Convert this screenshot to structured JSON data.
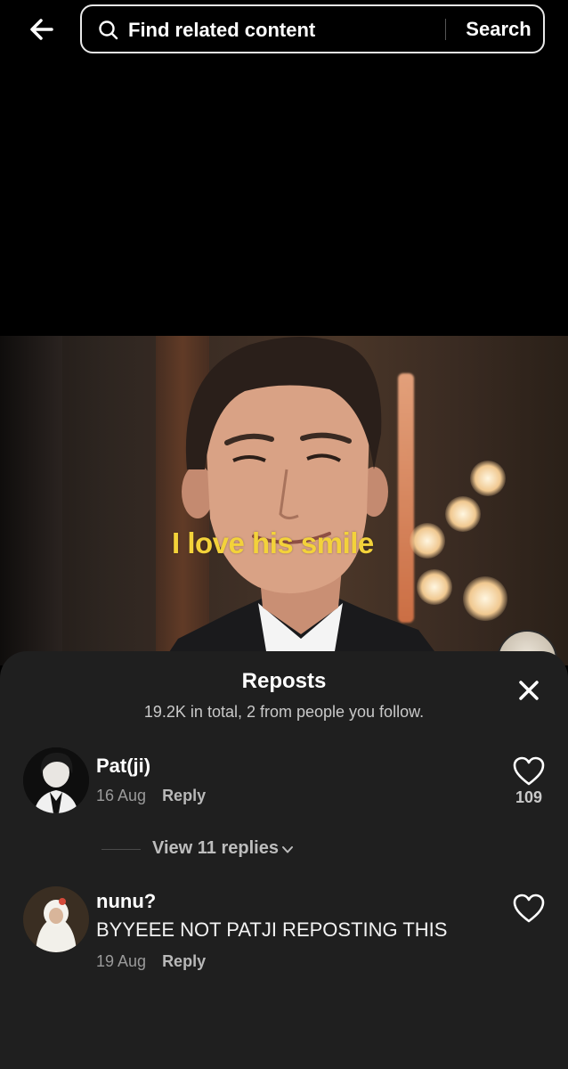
{
  "search": {
    "placeholder": "Find related content",
    "button_label": "Search"
  },
  "video": {
    "caption": "I love his smile"
  },
  "sheet": {
    "title": "Reposts",
    "subtitle": "19.2K in total, 2 from people you follow."
  },
  "comments": [
    {
      "username": "Pat(ji)",
      "text": "",
      "date": "16 Aug",
      "reply_label": "Reply",
      "likes": "109"
    },
    {
      "username": "nunu?",
      "text": "BYYEEE NOT PATJI REPOSTING THIS",
      "date": "19 Aug",
      "reply_label": "Reply",
      "likes": ""
    }
  ],
  "replies": {
    "label": "View 11 replies"
  },
  "colors": {
    "caption": "#f3d23a",
    "sheet_bg": "#1f1f1f",
    "background": "#000000"
  },
  "icons": [
    "back-arrow-icon",
    "search-icon",
    "close-icon",
    "heart-icon",
    "chevron-down-icon"
  ]
}
